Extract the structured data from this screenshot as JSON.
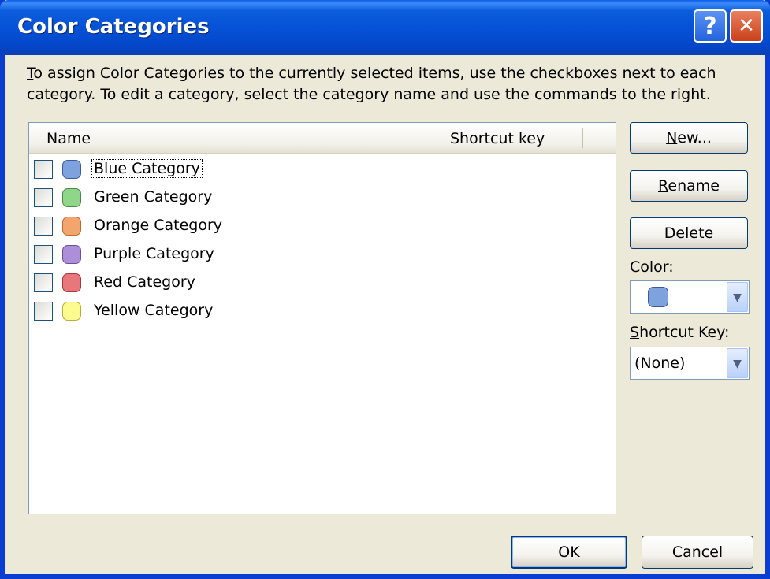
{
  "window": {
    "title": "Color Categories",
    "help_glyph": "?",
    "close_glyph": "✕"
  },
  "instructions": {
    "line1_first_letter": "T",
    "line1_rest": "o assign Color Categories to the currently selected items, use the checkboxes next to each",
    "line2": "category.  To edit a category, select the category name and use the commands to the right."
  },
  "list": {
    "columns": {
      "name": "Name",
      "shortcut": "Shortcut key"
    },
    "rows": [
      {
        "label": "Blue Category",
        "color": "#7ea2de",
        "border": "#3b5a99",
        "checked": false
      },
      {
        "label": "Green Category",
        "color": "#8fd68a",
        "border": "#4b8a46",
        "checked": false
      },
      {
        "label": "Orange Category",
        "color": "#f2a56c",
        "border": "#b86b36",
        "checked": false
      },
      {
        "label": "Purple Category",
        "color": "#ad8fd9",
        "border": "#6a4f99",
        "checked": false
      },
      {
        "label": "Red Category",
        "color": "#e7777b",
        "border": "#a9373c",
        "checked": false
      },
      {
        "label": "Yellow Category",
        "color": "#fbfb8f",
        "border": "#b7b03b",
        "checked": false
      }
    ]
  },
  "side": {
    "new_first": "N",
    "new_rest": "ew...",
    "rename_first": "R",
    "rename_rest": "ename",
    "delete_first": "D",
    "delete_rest": "elete",
    "color_label_pre": "C",
    "color_label_u": "o",
    "color_label_post": "lor:",
    "color_value": "#7ea2de",
    "shortcut_label_first": "S",
    "shortcut_label_rest": "hortcut Key:",
    "shortcut_value": "(None)",
    "arrow_glyph": "▼"
  },
  "footer": {
    "ok": "OK",
    "cancel": "Cancel"
  }
}
